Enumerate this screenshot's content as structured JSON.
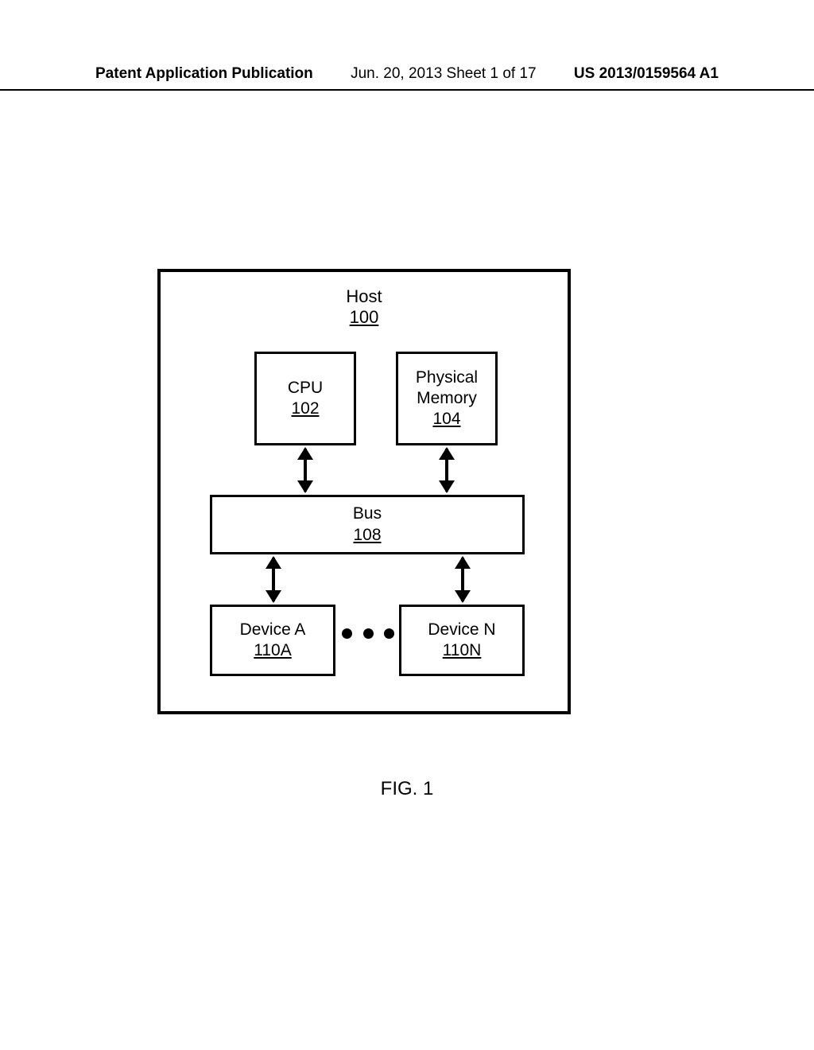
{
  "header": {
    "left": "Patent Application Publication",
    "mid": "Jun. 20, 2013  Sheet 1 of 17",
    "right": "US 2013/0159564 A1"
  },
  "figure_caption": "FIG. 1",
  "host": {
    "label": "Host",
    "ref": "100"
  },
  "cpu": {
    "label": "CPU",
    "ref": "102"
  },
  "mem": {
    "label1": "Physical",
    "label2": "Memory",
    "ref": "104"
  },
  "bus": {
    "label": "Bus",
    "ref": "108"
  },
  "devA": {
    "label": "Device A",
    "ref": "110A"
  },
  "devN": {
    "label": "Device N",
    "ref": "110N"
  }
}
